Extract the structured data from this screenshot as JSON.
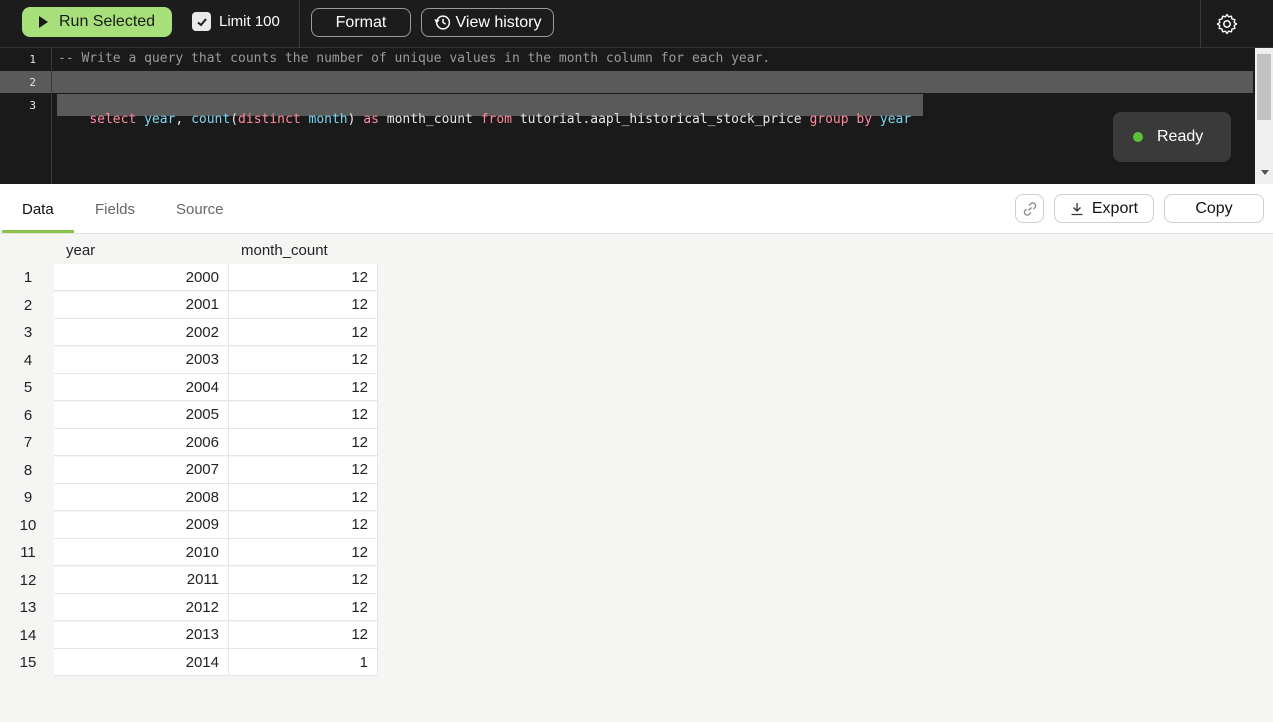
{
  "toolbar": {
    "run_label": "Run Selected",
    "limit_label": "Limit 100",
    "limit_checked": true,
    "format_label": "Format",
    "history_label": "View history",
    "icons": [
      "play-icon",
      "checkmark-icon",
      "history-icon",
      "gear-icon"
    ]
  },
  "editor": {
    "line_numbers": [
      "1",
      "2",
      "3"
    ],
    "line1": "-- Write a query that counts the number of unique values in the month column for each year.",
    "line3_tokens": {
      "t1": "select",
      "t2": " ",
      "t3": "year",
      "t4": ", ",
      "t5": "count",
      "t6": "(",
      "t7": "distinct",
      "t8": " ",
      "t9": "month",
      "t10": ") ",
      "t11": "as",
      "t12": " month_count ",
      "t13": "from",
      "t14": " tutorial.aapl_historical_stock_price ",
      "t15": "group",
      "t16": " ",
      "t17": "by",
      "t18": " ",
      "t19": "year"
    },
    "status": "Ready",
    "status_color": "#5cc23a"
  },
  "results": {
    "tabs": [
      "Data",
      "Fields",
      "Source"
    ],
    "active_tab": "Data",
    "export_label": "Export",
    "copy_label": "Copy",
    "columns": [
      "year",
      "month_count"
    ],
    "rows": [
      {
        "n": "1",
        "year": "2000",
        "month_count": "12"
      },
      {
        "n": "2",
        "year": "2001",
        "month_count": "12"
      },
      {
        "n": "3",
        "year": "2002",
        "month_count": "12"
      },
      {
        "n": "4",
        "year": "2003",
        "month_count": "12"
      },
      {
        "n": "5",
        "year": "2004",
        "month_count": "12"
      },
      {
        "n": "6",
        "year": "2005",
        "month_count": "12"
      },
      {
        "n": "7",
        "year": "2006",
        "month_count": "12"
      },
      {
        "n": "8",
        "year": "2007",
        "month_count": "12"
      },
      {
        "n": "9",
        "year": "2008",
        "month_count": "12"
      },
      {
        "n": "10",
        "year": "2009",
        "month_count": "12"
      },
      {
        "n": "11",
        "year": "2010",
        "month_count": "12"
      },
      {
        "n": "12",
        "year": "2011",
        "month_count": "12"
      },
      {
        "n": "13",
        "year": "2012",
        "month_count": "12"
      },
      {
        "n": "14",
        "year": "2013",
        "month_count": "12"
      },
      {
        "n": "15",
        "year": "2014",
        "month_count": "1"
      }
    ]
  },
  "colors": {
    "accent_green": "#a7e07a",
    "tab_underline": "#8bc34a",
    "editor_bg": "#1a1a1a",
    "keyword": "#ff8aa0",
    "identifier": "#7ad7f0"
  }
}
